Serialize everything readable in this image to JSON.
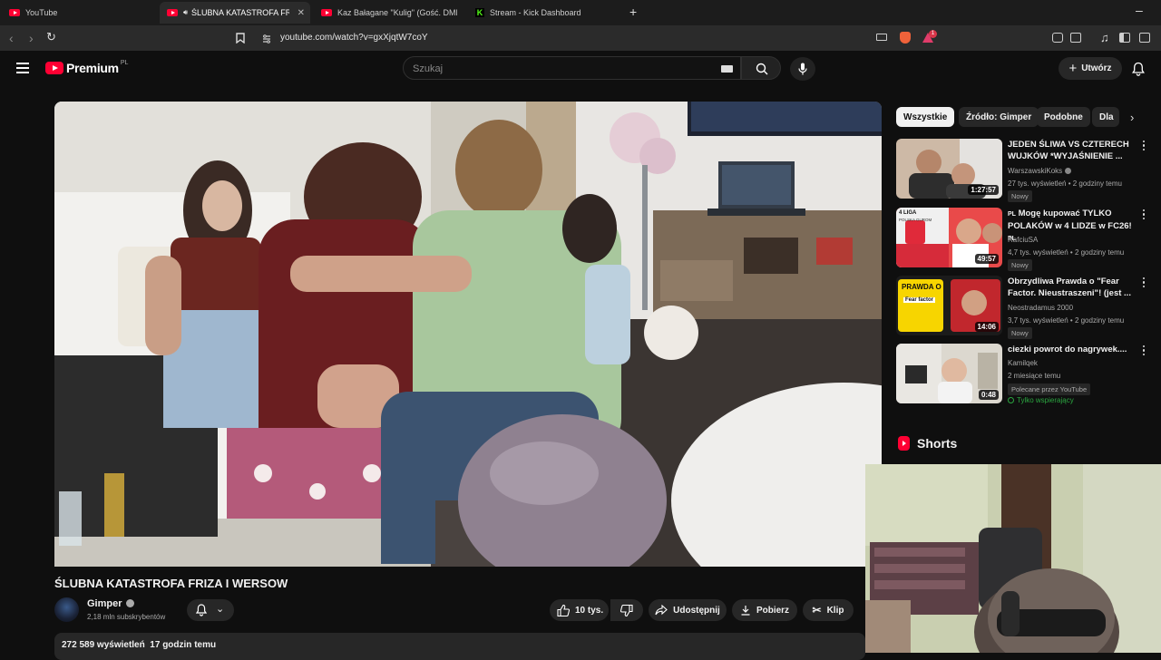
{
  "browser": {
    "tabs": [
      {
        "label": "YouTube",
        "favicon": "youtube-icon"
      },
      {
        "label": "ŚLUBNA KATASTROFA FRIZA I",
        "favicon": "youtube-icon",
        "audio": true,
        "active": true
      },
      {
        "label": "Kaz Bałagane \"Kulig\" (Gość. DMN)@",
        "favicon": "youtube-icon"
      },
      {
        "label": "Stream - Kick Dashboard",
        "favicon": "kick-icon"
      }
    ],
    "url": "youtube.com/watch?v=gxXjqtW7coY",
    "notification_count": "1"
  },
  "header": {
    "logo_text": "Premium",
    "logo_region": "PL",
    "search_placeholder": "Szukaj",
    "create_label": "Utwórz"
  },
  "video": {
    "title": "ŚLUBNA KATASTROFA FRIZA I WERSOW",
    "channel": "Gimper",
    "subscribers": "2,18 mln subskrybentów",
    "likes": "10 tys.",
    "share_label": "Udostępnij",
    "download_label": "Pobierz",
    "clip_label": "Klip",
    "views": "272 589 wyświetleń",
    "age": "17 godzin temu"
  },
  "chips": [
    "Wszystkie",
    "Źródło: Gimper",
    "Podobne",
    "Dla"
  ],
  "recommendations": [
    {
      "title": "JEDEN ŚLIWA VS CZTERECH WUJKÓW *WYJAŚNIENIE ...",
      "channel": "WarszawskiKoks",
      "meta": "27 tys. wyświetleń • 2 godziny temu",
      "badge": "Nowy",
      "duration": "1:27:57"
    },
    {
      "title_prefix": "PL",
      "title": "Mogę kupować TYLKO POLAKÓW w 4 LIDZE w FC26!",
      "title_suffix": "PL",
      "channel": "RafciuSA",
      "meta": "4,7 tys. wyświetleń • 2 godziny temu",
      "badge": "Nowy",
      "duration": "49:57",
      "thumb_text": "4 LIGA",
      "thumb_subtext": "POLSKA GUROM"
    },
    {
      "title": "Obrzydliwa Prawda o \"Fear Factor. Nieustraszeni\"! (jest ...",
      "channel": "Neostradamus 2000",
      "meta": "3,7 tys. wyświetleń • 2 godziny temu",
      "badge": "Nowy",
      "duration": "14:06",
      "thumb_text": "PRAWDA O",
      "thumb_subtext": "Fear factor"
    },
    {
      "title": "ciezki powrot do nagrywek....",
      "channel": "Kamilqek",
      "meta": "2 miesiące temu",
      "badge": "Polecane przez YouTube",
      "member": "Tylko wspierający",
      "duration": "0:48"
    }
  ],
  "shorts_label": "Shorts",
  "colors": {
    "youtube_red": "#ff0033",
    "background": "#0f0f0f",
    "surface": "#272727",
    "member_green": "#2ba640"
  }
}
